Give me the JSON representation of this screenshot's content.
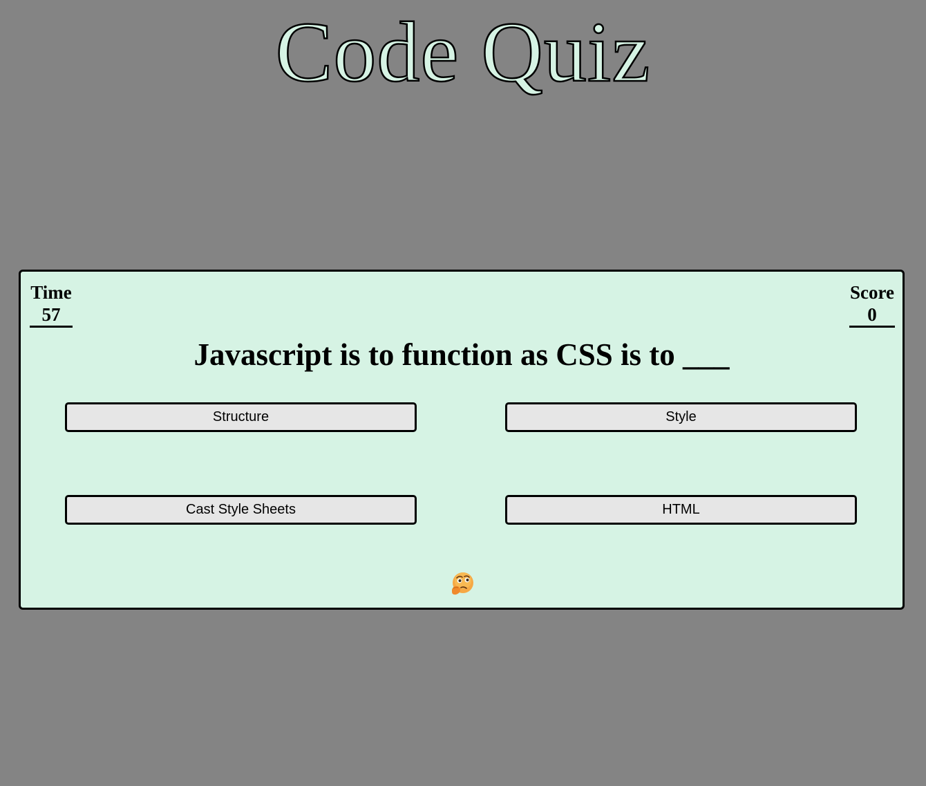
{
  "header": {
    "title": "Code Quiz"
  },
  "stats": {
    "time_label": "Time",
    "time_value": "57",
    "score_label": "Score",
    "score_value": "0"
  },
  "question": {
    "text": "Javascript is to function as CSS is to ___"
  },
  "answers": [
    {
      "label": "Structure"
    },
    {
      "label": "Style"
    },
    {
      "label": "Cast Style Sheets"
    },
    {
      "label": "HTML"
    }
  ],
  "feedback": {
    "icon": "thinking-face-icon"
  },
  "colors": {
    "background": "#848484",
    "card": "#d6f3e4",
    "button": "#e6e6e6",
    "border": "#000000"
  }
}
